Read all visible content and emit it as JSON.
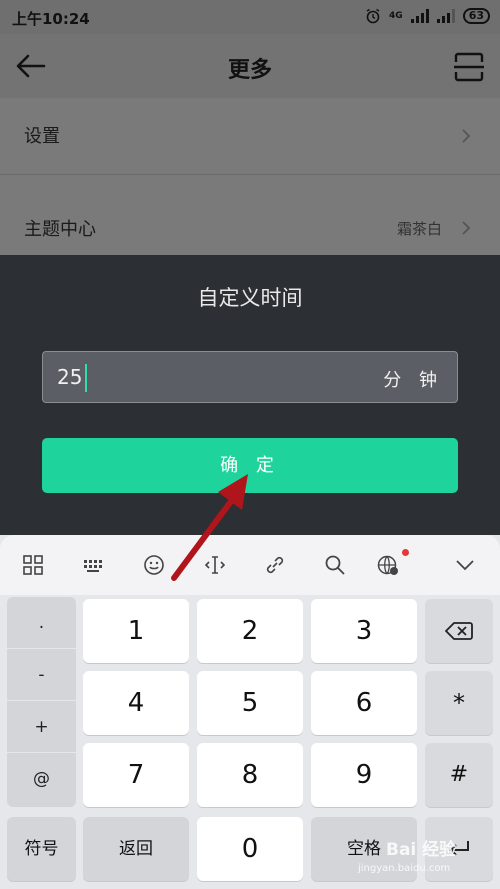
{
  "status_bar": {
    "time": "上午10:24",
    "network": "4G",
    "battery": "63"
  },
  "header": {
    "title": "更多"
  },
  "settings": {
    "items": [
      {
        "label": "设置",
        "value": ""
      },
      {
        "label": "主题中心",
        "value": "霜茶白"
      }
    ]
  },
  "dialog": {
    "title": "自定义时间",
    "input_value": "25",
    "unit": "分 钟",
    "confirm_label": "确 定"
  },
  "keyboard": {
    "toolbar_icons": [
      "grid-icon",
      "keyboard-icon",
      "emoji-icon",
      "cursor-icon",
      "link-icon",
      "search-icon",
      "globe-icon",
      "chevron-down-icon"
    ],
    "symbols": [
      ".",
      "-",
      "+",
      "@"
    ],
    "keys": {
      "k1": "1",
      "k2": "2",
      "k3": "3",
      "k4": "4",
      "k5": "5",
      "k6": "6",
      "k7": "7",
      "k8": "8",
      "k9": "9",
      "k0": "0",
      "star": "*",
      "hash": "#",
      "fuhao": "符号",
      "back": "返回",
      "space": "空格"
    }
  },
  "watermark": {
    "text": "Bai 经验",
    "sub": "jingyan.baidu.com"
  },
  "colors": {
    "accent": "#1fd39c",
    "dialog_bg": "#2c2f33",
    "arrow": "#b0151c"
  }
}
